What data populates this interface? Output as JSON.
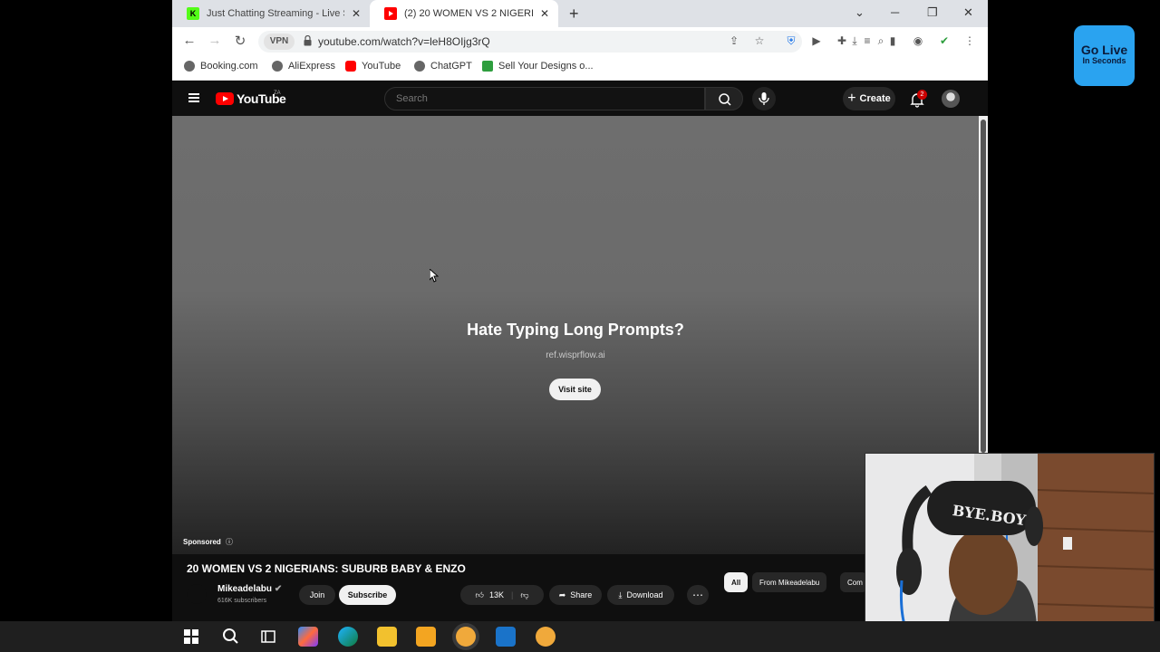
{
  "browser": {
    "tabs": [
      {
        "label": "Just Chatting Streaming - Live St",
        "favicon": "kick-icon"
      },
      {
        "label": "(2) 20 WOMEN VS 2 NIGERIANS:",
        "favicon": "youtube-icon",
        "active": true
      }
    ],
    "vpn_label": "VPN",
    "url": "youtube.com/watch?v=leH8OIjg3rQ",
    "bookmarks": [
      {
        "label": "Booking.com",
        "icon": "globe-icon"
      },
      {
        "label": "AliExpress",
        "icon": "globe-icon"
      },
      {
        "label": "YouTube",
        "icon": "youtube-icon"
      },
      {
        "label": "ChatGPT",
        "icon": "globe-icon"
      },
      {
        "label": "Sell Your Designs o...",
        "icon": "tshirt-icon"
      }
    ]
  },
  "youtube": {
    "logo_text": "YouTube",
    "country_code": "ZA",
    "search_placeholder": "Search",
    "create_label": "Create",
    "notification_count": "2",
    "ad": {
      "headline": "Hate Typing Long Prompts?",
      "url": "ref.wisprflow.ai",
      "cta": "Visit site",
      "sponsored": "Sponsored"
    },
    "video": {
      "title": "20 WOMEN VS 2 NIGERIANS: SUBURB BABY & ENZO",
      "channel": "Mikeadelabu",
      "subscribers": "616K subscribers",
      "join_label": "Join",
      "subscribe_label": "Subscribe",
      "likes": "13K",
      "share_label": "Share",
      "download_label": "Download"
    },
    "chips": [
      "All",
      "From Mikeadelabu",
      "Com"
    ]
  },
  "overlay": {
    "golive_line1": "Go Live",
    "golive_line2": "In Seconds",
    "beanie_text": "BYE.BOY"
  },
  "colors": {
    "youtube_red": "#ff0000",
    "golive_blue": "#2aa3f0"
  }
}
